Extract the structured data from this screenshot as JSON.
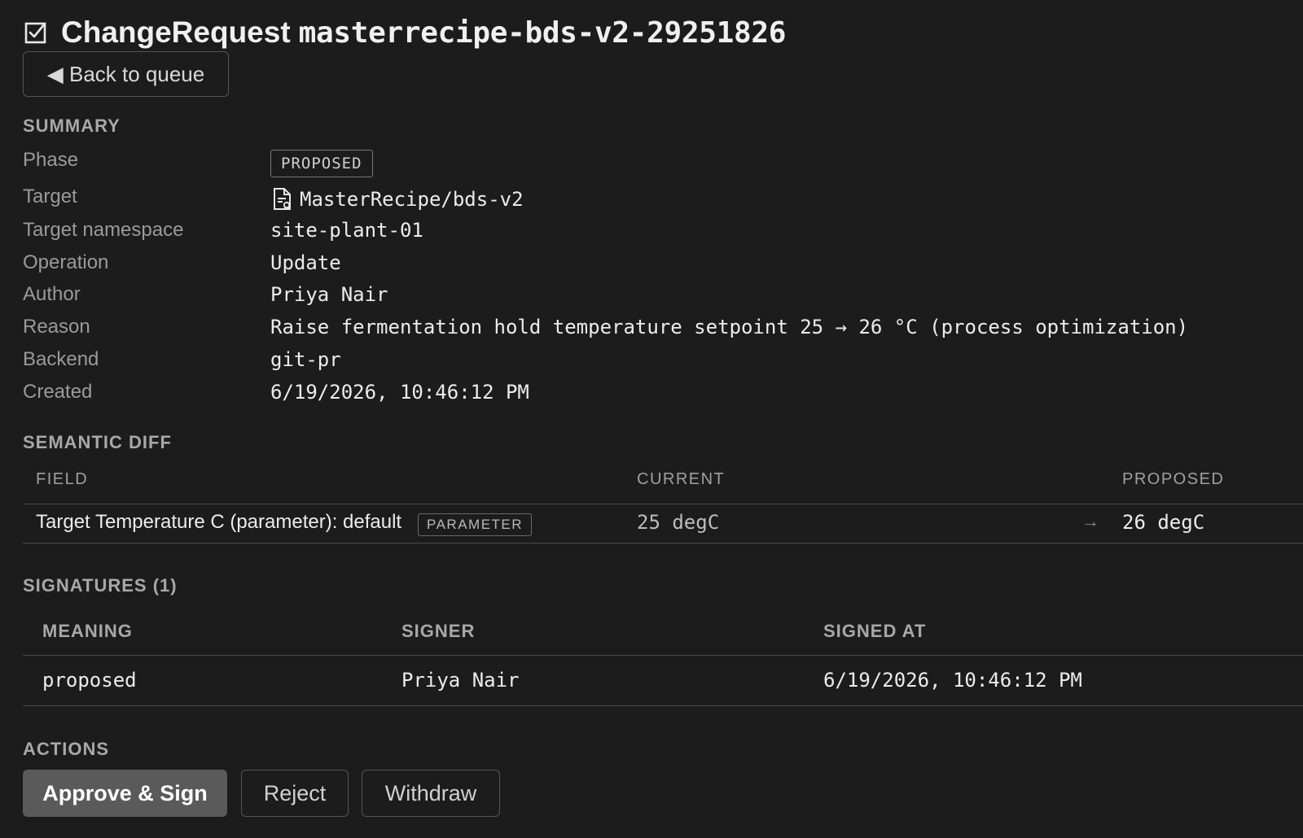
{
  "header": {
    "kind": "ChangeRequest",
    "name": "masterrecipe-bds-v2-29251826",
    "back_label": "◀ Back to queue"
  },
  "summary": {
    "heading": "SUMMARY",
    "labels": {
      "phase": "Phase",
      "target": "Target",
      "namespace": "Target namespace",
      "operation": "Operation",
      "author": "Author",
      "reason": "Reason",
      "backend": "Backend",
      "created": "Created"
    },
    "values": {
      "phase": "PROPOSED",
      "target": "MasterRecipe/bds-v2",
      "namespace": "site-plant-01",
      "operation": "Update",
      "author": "Priya Nair",
      "reason": "Raise fermentation hold temperature setpoint 25 → 26 °C (process optimization)",
      "backend": "git-pr",
      "created": "6/19/2026, 10:46:12 PM"
    }
  },
  "diff": {
    "heading": "SEMANTIC DIFF",
    "columns": {
      "field": "FIELD",
      "current": "CURRENT",
      "proposed": "PROPOSED"
    },
    "rows": [
      {
        "field": "Target Temperature C (parameter): default",
        "badge": "PARAMETER",
        "current": "25 degC",
        "arrow": "→",
        "proposed": "26 degC"
      }
    ]
  },
  "signatures": {
    "heading": "SIGNATURES (1)",
    "columns": {
      "meaning": "MEANING",
      "signer": "SIGNER",
      "signed_at": "SIGNED AT"
    },
    "rows": [
      {
        "meaning": "proposed",
        "signer": "Priya Nair",
        "signed_at": "6/19/2026, 10:46:12 PM"
      }
    ]
  },
  "actions": {
    "heading": "ACTIONS",
    "approve": "Approve & Sign",
    "reject": "Reject",
    "withdraw": "Withdraw"
  },
  "icons": {
    "title": "checkbox-checked-icon",
    "target": "document-icon"
  },
  "colors": {
    "background": "#1c1c1c",
    "text": "#ececec",
    "muted": "#9a9a9a",
    "primary_button": "#5a5a5a"
  }
}
